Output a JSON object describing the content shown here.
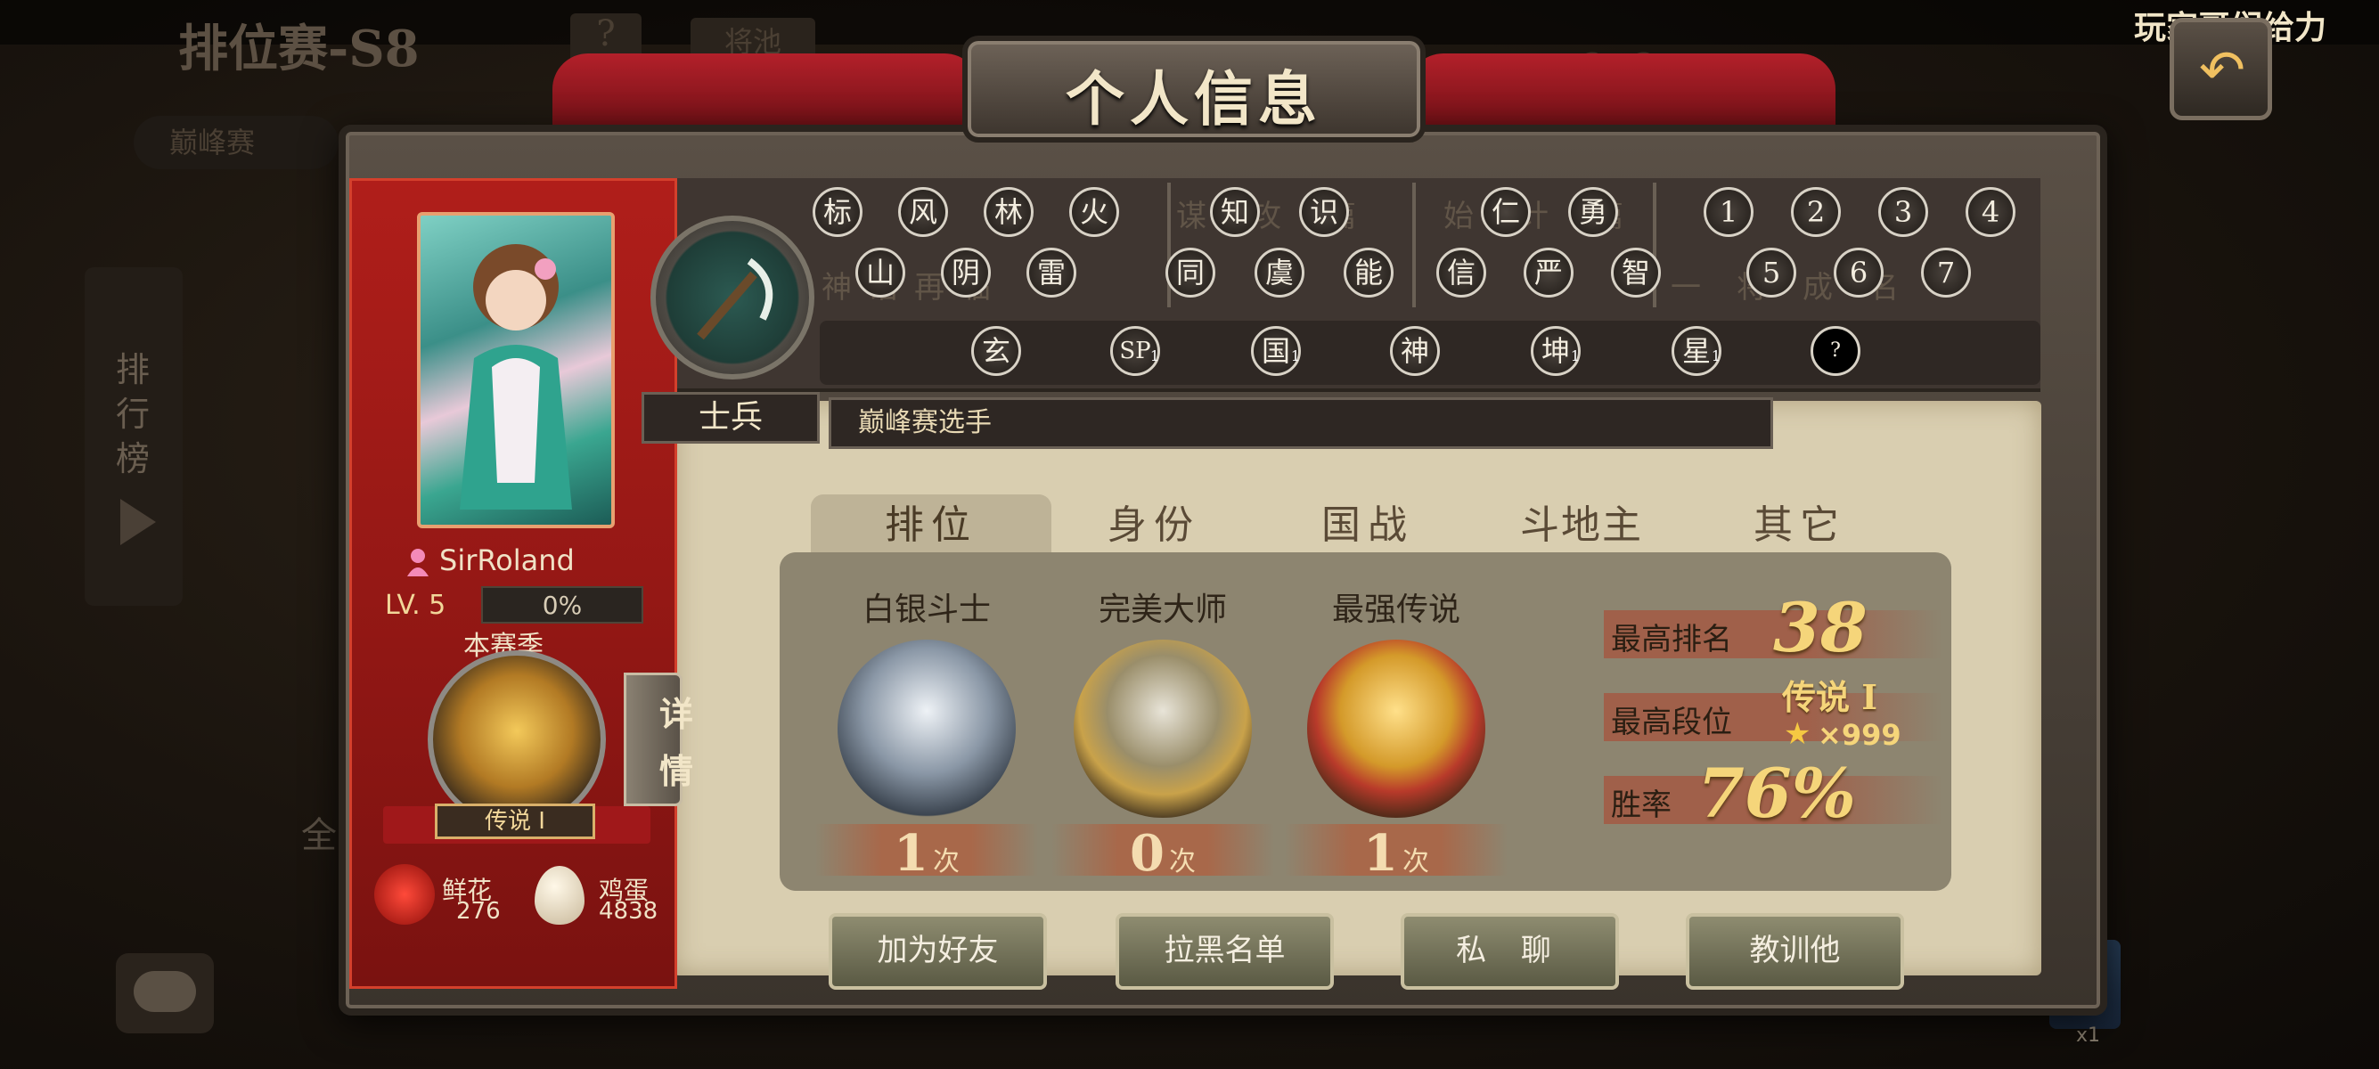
{
  "background": {
    "season_title": "排位赛-S8",
    "help_label": "?",
    "pool_label": "将池",
    "mode_label": "2v2",
    "peak_label": "巅峰赛",
    "leaderboard_label": "排行榜",
    "chat_partial": "全",
    "gift_count": "x1",
    "ticker_text": "玩家哥们给力"
  },
  "panel": {
    "title": "个人信息"
  },
  "profile": {
    "name": "SirRoland",
    "level": "LV. 5",
    "exp": "0%",
    "season_label": "本赛季",
    "season_rank": "传说 I",
    "detail_label": "详情",
    "flowers_label": "鲜花",
    "flowers_count": "276",
    "eggs_label": "鸡蛋",
    "eggs_count": "4838"
  },
  "identity": {
    "class_label": "士兵",
    "player_title": "巅峰赛选手"
  },
  "achievements": {
    "group1_row1": [
      "标",
      "风",
      "林",
      "火"
    ],
    "group1_row2": [
      "山",
      "阴",
      "雷"
    ],
    "group2_row1": [
      "知",
      "识"
    ],
    "group2_row2": [
      "同",
      "虞",
      "能"
    ],
    "group3_row1": [
      "仁",
      "勇"
    ],
    "group3_row2": [
      "信",
      "严",
      "智"
    ],
    "group4_row1": [
      "1",
      "2",
      "3",
      "4"
    ],
    "group4_row2": [
      "5",
      "6",
      "7"
    ],
    "bottom_row": [
      {
        "label": "玄",
        "sub": ""
      },
      {
        "label": "SP",
        "sub": "1"
      },
      {
        "label": "国",
        "sub": "1"
      },
      {
        "label": "神",
        "sub": ""
      },
      {
        "label": "坤",
        "sub": "1"
      },
      {
        "label": "星",
        "sub": "1"
      },
      {
        "label": "?",
        "sub": ""
      }
    ],
    "ghost_group1": "神话再临",
    "ghost_group2": "谋攻篇",
    "ghost_group3": "始计篇",
    "ghost_group4": "一将成名"
  },
  "tabs": [
    "排位",
    "身份",
    "国战",
    "斗地主",
    "其它"
  ],
  "ranks": [
    {
      "name": "白银斗士",
      "count": "1",
      "unit": "次"
    },
    {
      "name": "完美大师",
      "count": "0",
      "unit": "次"
    },
    {
      "name": "最强传说",
      "count": "1",
      "unit": "次"
    }
  ],
  "stats": {
    "best_rank_label": "最高排名",
    "best_rank_value": "38",
    "best_tier_label": "最高段位",
    "best_tier_value": "传说 I",
    "best_tier_stars": "×999",
    "win_rate_label": "胜率",
    "win_rate_value": "76%"
  },
  "actions": [
    "加为好友",
    "拉黑名单",
    "私 聊",
    "教训他"
  ]
}
